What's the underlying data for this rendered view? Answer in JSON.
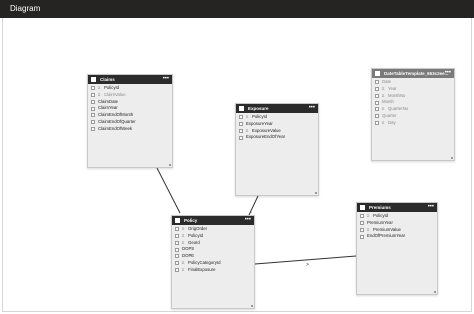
{
  "window": {
    "title": "Diagram"
  },
  "colors": {
    "titlebar": "#252423",
    "card_header": "#2b2b2b",
    "card_body": "#ededed",
    "line": "#333333"
  },
  "relationships": [
    {
      "from": "Claims",
      "to": "Policy",
      "from_marker": "",
      "to_marker": ""
    },
    {
      "from": "Exposure",
      "to": "Policy",
      "from_marker": "",
      "to_marker": ""
    },
    {
      "from": "Premiums",
      "to": "Policy",
      "from_marker": "",
      "to_marker": ""
    }
  ],
  "tables": {
    "claims": {
      "name": "Claims",
      "fields": [
        {
          "label": "PolicyId",
          "sigma": true,
          "dim": false
        },
        {
          "label": "ClaimValue",
          "sigma": true,
          "dim": true
        },
        {
          "label": "ClaimDate",
          "sigma": false,
          "dim": false
        },
        {
          "label": "ClaimYear",
          "sigma": false,
          "dim": false
        },
        {
          "label": "ClaimEndOfMonth",
          "sigma": false,
          "dim": false
        },
        {
          "label": "ClaimEndOfQuarter",
          "sigma": false,
          "dim": false
        },
        {
          "label": "ClaimEndOfWeek",
          "sigma": false,
          "dim": false
        }
      ]
    },
    "exposure": {
      "name": "Exposure",
      "fields": [
        {
          "label": "PolicyId",
          "sigma": true,
          "dim": false
        },
        {
          "label": "ExposureYear",
          "sigma": false,
          "dim": false
        },
        {
          "label": "ExposureValue",
          "sigma": true,
          "dim": false
        },
        {
          "label": "ExposureEndOfYear",
          "sigma": false,
          "dim": false
        }
      ]
    },
    "datetable": {
      "name": "DateTableTemplate_653c2ee...",
      "fields": [
        {
          "label": "Date",
          "sigma": false,
          "dim": true
        },
        {
          "label": "Year",
          "sigma": true,
          "dim": true
        },
        {
          "label": "MonthNo",
          "sigma": true,
          "dim": true
        },
        {
          "label": "Month",
          "sigma": false,
          "dim": true
        },
        {
          "label": "QuarterNo",
          "sigma": true,
          "dim": true
        },
        {
          "label": "Quarter",
          "sigma": false,
          "dim": true
        },
        {
          "label": "Day",
          "sigma": true,
          "dim": true
        }
      ]
    },
    "policy": {
      "name": "Policy",
      "fields": [
        {
          "label": "OrigOrder",
          "sigma": true,
          "dim": false
        },
        {
          "label": "PolicyId",
          "sigma": true,
          "dim": false
        },
        {
          "label": "GeoId",
          "sigma": true,
          "dim": false
        },
        {
          "label": "DOPS",
          "sigma": false,
          "dim": false
        },
        {
          "label": "DOPE",
          "sigma": false,
          "dim": false
        },
        {
          "label": "PolicyCategoryId",
          "sigma": true,
          "dim": false
        },
        {
          "label": "FinalExposure",
          "sigma": true,
          "dim": false
        }
      ]
    },
    "premiums": {
      "name": "Premiums",
      "fields": [
        {
          "label": "PolicyId",
          "sigma": true,
          "dim": false
        },
        {
          "label": "PremiumYear",
          "sigma": false,
          "dim": false
        },
        {
          "label": "PremiumValue",
          "sigma": true,
          "dim": false
        },
        {
          "label": "EndOfPremiumYear",
          "sigma": false,
          "dim": false
        }
      ]
    }
  }
}
